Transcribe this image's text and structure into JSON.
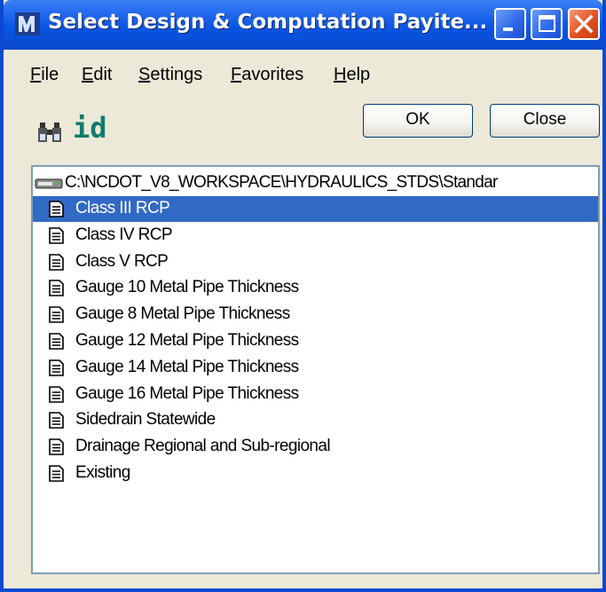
{
  "window": {
    "title": "Select Design & Computation Payite..."
  },
  "menu": {
    "items": [
      "File",
      "Edit",
      "Settings",
      "Favorites",
      "Help"
    ]
  },
  "toolbar": {
    "id_label": "id",
    "ok_label": "OK",
    "close_label": "Close"
  },
  "list": {
    "path": "C:\\NCDOT_V8_WORKSPACE\\HYDRAULICS_STDS\\Standar",
    "selected_index": 0,
    "items": [
      "Class III RCP",
      "Class IV RCP",
      "Class V RCP",
      "Gauge 10 Metal Pipe Thickness",
      "Gauge 8 Metal Pipe Thickness",
      "Gauge 12 Metal Pipe Thickness",
      "Gauge 14 Metal Pipe Thickness",
      "Gauge 16 Metal Pipe Thickness",
      "Sidedrain Statewide",
      "Drainage  Regional and Sub-regional",
      "Existing"
    ]
  },
  "colors": {
    "titlebar": "#0b55e3",
    "selection": "#316ac5",
    "id_label": "#117a6e"
  }
}
